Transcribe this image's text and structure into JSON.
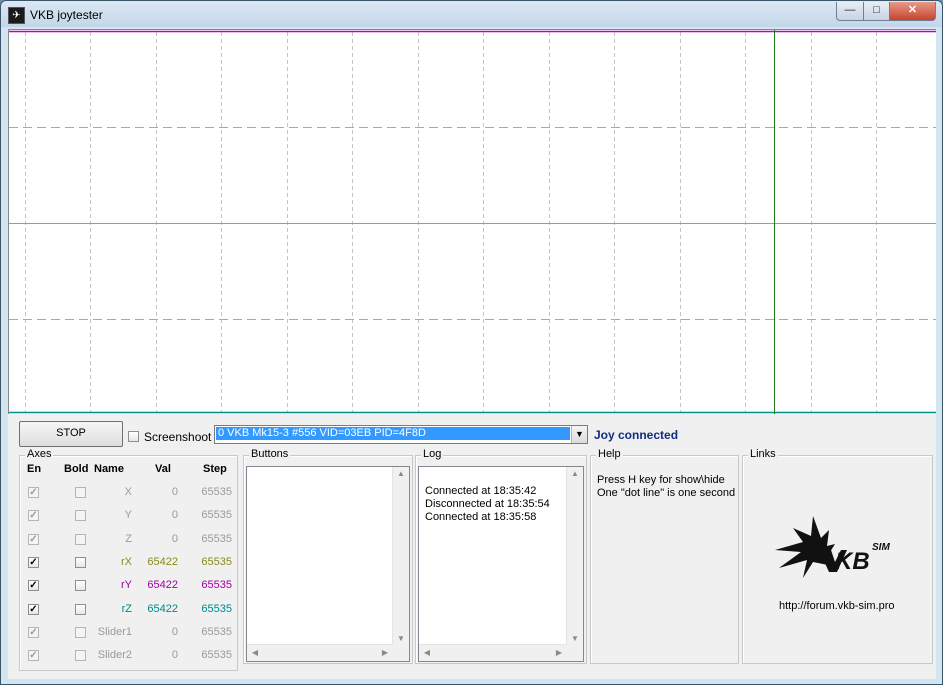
{
  "window": {
    "title": "VKB joytester",
    "app_icon": "vkb-logo-icon",
    "minimize": "—",
    "maximize": "□",
    "close": "✕"
  },
  "colors": {
    "top_line": "#c000c0",
    "cursor_line": "#1e7a1e",
    "bottom_line": "#009090",
    "rX": "#8a8a1a",
    "rY": "#a000a0",
    "rZ": "#008888",
    "status": "#0e2d83"
  },
  "controls": {
    "stop_label": "STOP",
    "screenshot_label": "Screenshoot",
    "screenshot_checked": false,
    "device": "0 VKB Mk15-3 #556 VID=03EB PID=4F8D",
    "status": "Joy connected"
  },
  "axes": {
    "title": "Axes",
    "headers": {
      "en": "En",
      "bold": "Bold",
      "name": "Name",
      "val": "Val",
      "step": "Step"
    },
    "rows": [
      {
        "name": "X",
        "val": "0",
        "step": "65535",
        "enabled": true,
        "disabled": true,
        "bold": false,
        "color": "#9a9a9a"
      },
      {
        "name": "Y",
        "val": "0",
        "step": "65535",
        "enabled": true,
        "disabled": true,
        "bold": false,
        "color": "#9a9a9a"
      },
      {
        "name": "Z",
        "val": "0",
        "step": "65535",
        "enabled": true,
        "disabled": true,
        "bold": false,
        "color": "#9a9a9a"
      },
      {
        "name": "rX",
        "val": "65422",
        "step": "65535",
        "enabled": true,
        "disabled": false,
        "bold": false,
        "color": "#8a8a1a"
      },
      {
        "name": "rY",
        "val": "65422",
        "step": "65535",
        "enabled": true,
        "disabled": false,
        "bold": false,
        "color": "#a000a0"
      },
      {
        "name": "rZ",
        "val": "65422",
        "step": "65535",
        "enabled": true,
        "disabled": false,
        "bold": false,
        "color": "#008888"
      },
      {
        "name": "Slider1",
        "val": "0",
        "step": "65535",
        "enabled": true,
        "disabled": true,
        "bold": false,
        "color": "#9a9a9a"
      },
      {
        "name": "Slider2",
        "val": "0",
        "step": "65535",
        "enabled": true,
        "disabled": true,
        "bold": false,
        "color": "#9a9a9a"
      }
    ]
  },
  "buttons_panel": {
    "title": "Buttons"
  },
  "log": {
    "title": "Log",
    "lines": [
      "Connected at 18:35:42",
      "Disconnected at 18:35:54",
      "Connected at 18:35:58"
    ]
  },
  "help": {
    "title": "Help",
    "lines": [
      "Press H key for show\\hide",
      "One \"dot line\" is one second"
    ]
  },
  "links": {
    "title": "Links",
    "logo_text": "KB",
    "logo_sup": "SIM",
    "url": "http://forum.vkb-sim.pro"
  }
}
